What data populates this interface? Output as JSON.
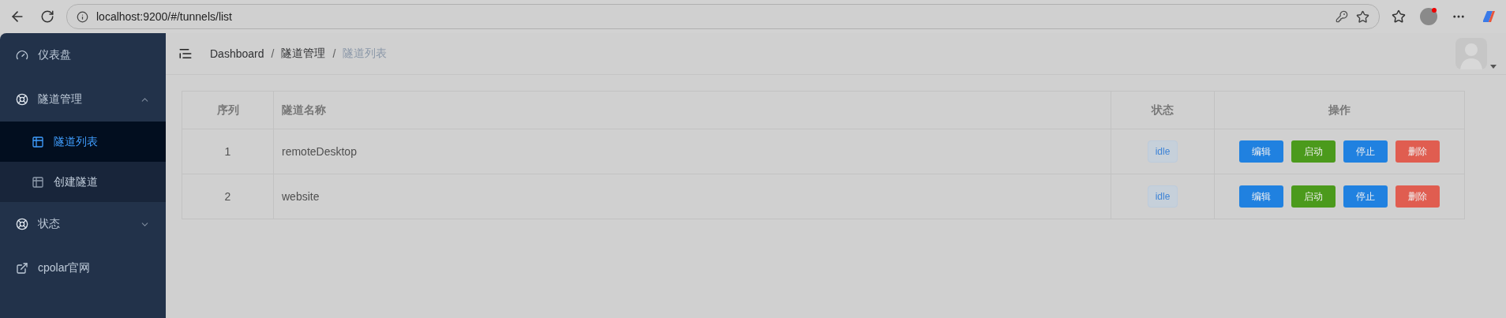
{
  "browser": {
    "url": "localhost:9200/#/tunnels/list",
    "profile_notification": true
  },
  "sidebar": {
    "items": [
      {
        "kind": "page",
        "label": "仪表盘",
        "selected": false
      },
      {
        "kind": "submenu",
        "label": "隧道管理",
        "expanded": true,
        "children": [
          {
            "label": "隧道列表",
            "selected": true
          },
          {
            "label": "创建隧道",
            "selected": false
          }
        ]
      },
      {
        "kind": "submenu",
        "label": "状态",
        "expanded": false
      },
      {
        "kind": "external",
        "label": "cpolar官网",
        "selected": false
      }
    ]
  },
  "breadcrumb": [
    {
      "label": "Dashboard",
      "current": false
    },
    {
      "label": "隧道管理",
      "current": false
    },
    {
      "label": "隧道列表",
      "current": true
    }
  ],
  "breadcrumb_separator": "/",
  "table": {
    "columns": [
      "序列",
      "隧道名称",
      "状态",
      "操作"
    ],
    "rows": [
      {
        "index": "1",
        "name": "remoteDesktop",
        "status": "idle",
        "actions": [
          {
            "label": "编辑",
            "kind": "primary"
          },
          {
            "label": "启动",
            "kind": "success"
          },
          {
            "label": "停止",
            "kind": "primary"
          },
          {
            "label": "删除",
            "kind": "danger"
          }
        ]
      },
      {
        "index": "2",
        "name": "website",
        "status": "idle",
        "actions": [
          {
            "label": "编辑",
            "kind": "primary"
          },
          {
            "label": "启动",
            "kind": "success"
          },
          {
            "label": "停止",
            "kind": "primary"
          },
          {
            "label": "删除",
            "kind": "danger"
          }
        ]
      }
    ]
  }
}
